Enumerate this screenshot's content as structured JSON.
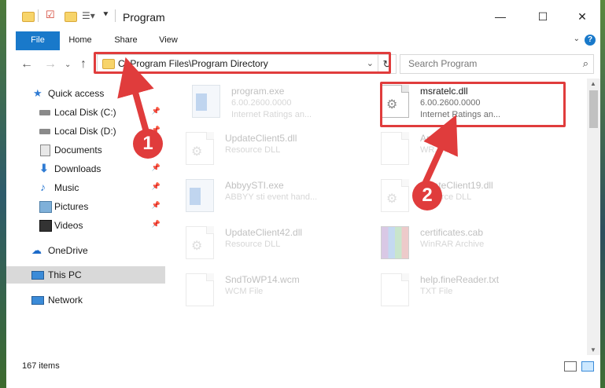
{
  "window": {
    "title": "Program",
    "minimize_icon": "minimize-icon",
    "maximize_icon": "maximize-icon",
    "close_icon": "close-icon"
  },
  "ribbon": {
    "tabs": [
      {
        "label": "File"
      },
      {
        "label": "Home"
      },
      {
        "label": "Share"
      },
      {
        "label": "View"
      }
    ]
  },
  "nav": {
    "address": "C:\\Program Files\\Program Directory",
    "search_placeholder": "Search Program"
  },
  "sidebar": {
    "items": [
      {
        "label": "Quick access",
        "icon": "star-icon",
        "pinned": false
      },
      {
        "label": "Local Disk (C:)",
        "icon": "disk-icon",
        "pinned": true
      },
      {
        "label": "Local Disk (D:)",
        "icon": "disk-icon",
        "pinned": true
      },
      {
        "label": "Documents",
        "icon": "documents-icon",
        "pinned": true
      },
      {
        "label": "Downloads",
        "icon": "download-icon",
        "pinned": true
      },
      {
        "label": "Music",
        "icon": "music-icon",
        "pinned": true
      },
      {
        "label": "Pictures",
        "icon": "pictures-icon",
        "pinned": true
      },
      {
        "label": "Videos",
        "icon": "videos-icon",
        "pinned": true
      },
      {
        "label": "OneDrive",
        "icon": "onedrive-icon",
        "pinned": false
      },
      {
        "label": "This PC",
        "icon": "pc-icon",
        "pinned": false,
        "selected": true
      },
      {
        "label": "Network",
        "icon": "network-icon",
        "pinned": false
      }
    ]
  },
  "files": [
    {
      "name": "program.exe",
      "line2": "6.00.2600.0000",
      "line3": "Internet Ratings an...",
      "icon": "exe-icon",
      "faded": true
    },
    {
      "name": "msratelc.dll",
      "line2": "6.00.2600.0000",
      "line3": "Internet Ratings an...",
      "icon": "dll-icon",
      "faded": false
    },
    {
      "name": "UpdateClient5.dll",
      "line2": "Resource DLL",
      "icon": "dll-icon",
      "faded": true
    },
    {
      "name": "Ar...rd",
      "line2": "WR... File",
      "icon": "document-icon",
      "faded": true
    },
    {
      "name": "AbbyySTI.exe",
      "line2": "ABBYY sti event hand...",
      "icon": "exe-icon",
      "faded": true
    },
    {
      "name": "...dateClient19.dll",
      "line2": "...source DLL",
      "icon": "dll-icon",
      "faded": true
    },
    {
      "name": "UpdateClient42.dll",
      "line2": "Resource DLL",
      "icon": "dll-icon",
      "faded": true
    },
    {
      "name": "certificates.cab",
      "line2": "WinRAR Archive",
      "icon": "rar-icon",
      "faded": true
    },
    {
      "name": "SndToWP14.wcm",
      "line2": "WCM File",
      "icon": "document-icon",
      "faded": true
    },
    {
      "name": "help.fineReader.txt",
      "line2": "TXT File",
      "icon": "document-icon",
      "faded": true
    }
  ],
  "status": {
    "item_count": "167 items"
  },
  "callouts": {
    "first": "1",
    "second": "2"
  },
  "colors": {
    "accent": "#1979ca",
    "highlight": "#e03c3c",
    "selection": "#d9d9d9"
  }
}
